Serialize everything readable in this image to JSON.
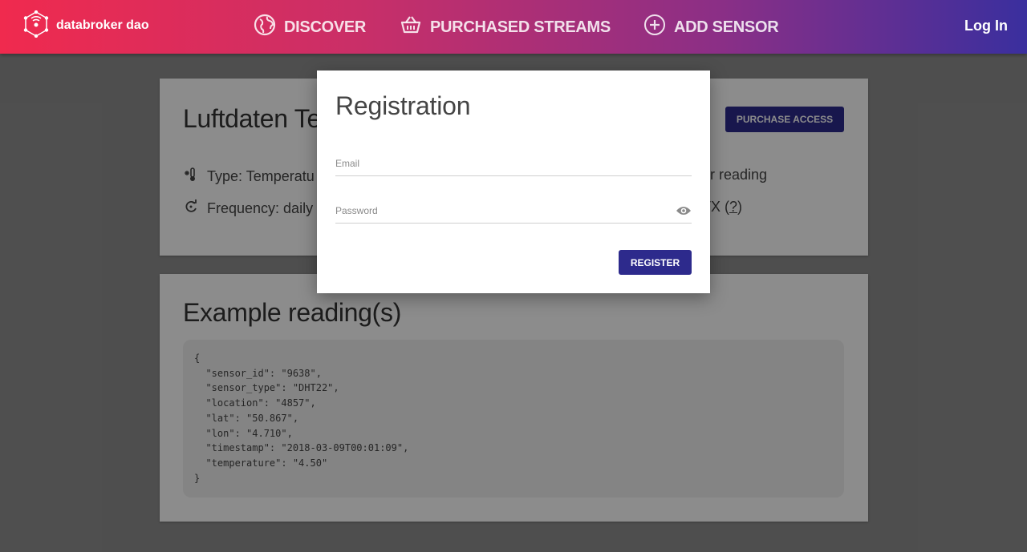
{
  "nav": {
    "brand": "databroker dao",
    "items": [
      {
        "label": "DISCOVER",
        "icon": "globe-icon"
      },
      {
        "label": "PURCHASED STREAMS",
        "icon": "basket-icon"
      },
      {
        "label": "ADD SENSOR",
        "icon": "plus-circle-icon"
      }
    ],
    "login": "Log In"
  },
  "sensor": {
    "title_visible": "Luftdaten Te",
    "purchase_label": "PURCHASE ACCESS",
    "type_label": "Type: Temperatu",
    "frequency_label": "Frequency: daily",
    "right_col_1": "er reading",
    "right_col_2_prefix": "TX (",
    "right_col_2_link": "?",
    "right_col_2_suffix": ")"
  },
  "example": {
    "title": "Example reading(s)",
    "code": "{\n  \"sensor_id\": \"9638\",\n  \"sensor_type\": \"DHT22\",\n  \"location\": \"4857\",\n  \"lat\": \"50.867\",\n  \"lon\": \"4.710\",\n  \"timestamp\": \"2018-03-09T00:01:09\",\n  \"temperature\": \"4.50\"\n}"
  },
  "modal": {
    "title": "Registration",
    "email_placeholder": "Email",
    "password_placeholder": "Password",
    "register_label": "REGISTER"
  },
  "colors": {
    "primary_button": "#2d2a8c",
    "nav_gradient_start": "#f02a4e",
    "nav_gradient_end": "#3a2f9e"
  }
}
